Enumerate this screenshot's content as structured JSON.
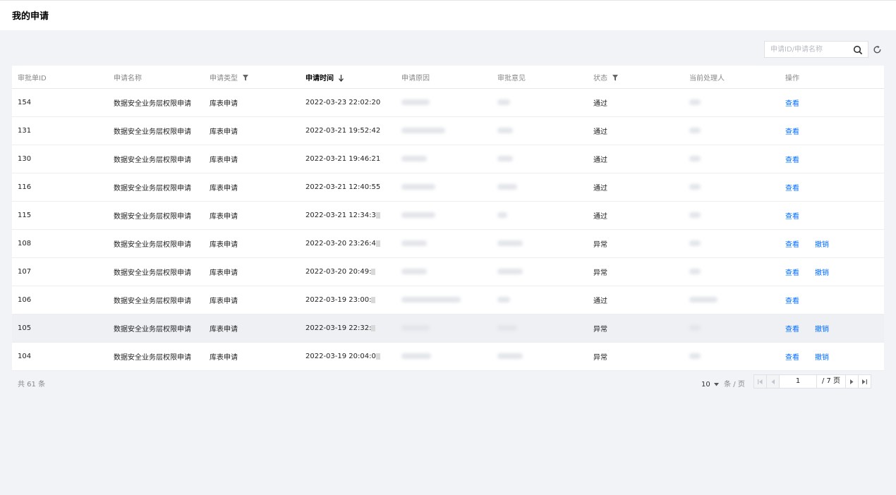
{
  "page": {
    "title": "我的申请"
  },
  "search": {
    "placeholder": "申请ID/申请名称"
  },
  "table": {
    "columns": [
      "审批单ID",
      "申请名称",
      "申请类型",
      "申请时间",
      "申请原因",
      "审批意见",
      "状态",
      "当前处理人",
      "操作"
    ],
    "rows": [
      {
        "id": "154",
        "name": "数据安全业务层权限申请",
        "type": "库表申请",
        "time": "2022-03-23 22:02:20",
        "status": "通过",
        "actions": [
          "查看"
        ]
      },
      {
        "id": "131",
        "name": "数据安全业务层权限申请",
        "type": "库表申请",
        "time": "2022-03-21 19:52:42",
        "status": "通过",
        "actions": [
          "查看"
        ]
      },
      {
        "id": "130",
        "name": "数据安全业务层权限申请",
        "type": "库表申请",
        "time": "2022-03-21 19:46:21",
        "status": "通过",
        "actions": [
          "查看"
        ]
      },
      {
        "id": "116",
        "name": "数据安全业务层权限申请",
        "type": "库表申请",
        "time": "2022-03-21 12:40:55",
        "status": "通过",
        "actions": [
          "查看"
        ]
      },
      {
        "id": "115",
        "name": "数据安全业务层权限申请",
        "type": "库表申请",
        "time": "2022-03-21 12:34:3",
        "status": "通过",
        "actions": [
          "查看"
        ]
      },
      {
        "id": "108",
        "name": "数据安全业务层权限申请",
        "type": "库表申请",
        "time": "2022-03-20 23:26:4",
        "status": "异常",
        "actions": [
          "查看",
          "撤销"
        ]
      },
      {
        "id": "107",
        "name": "数据安全业务层权限申请",
        "type": "库表申请",
        "time": "2022-03-20 20:49:",
        "status": "异常",
        "actions": [
          "查看",
          "撤销"
        ]
      },
      {
        "id": "106",
        "name": "数据安全业务层权限申请",
        "type": "库表申请",
        "time": "2022-03-19 23:00:",
        "status": "通过",
        "actions": [
          "查看"
        ]
      },
      {
        "id": "105",
        "name": "数据安全业务层权限申请",
        "type": "库表申请",
        "time": "2022-03-19 22:32:",
        "status": "异常",
        "actions": [
          "查看",
          "撤销"
        ]
      },
      {
        "id": "104",
        "name": "数据安全业务层权限申请",
        "type": "库表申请",
        "time": "2022-03-19 20:04:0",
        "status": "异常",
        "actions": [
          "查看",
          "撤销"
        ]
      }
    ]
  },
  "footer": {
    "total": "共 61 条",
    "page_size": "10",
    "page_size_unit": "条 / 页",
    "current_page": "1",
    "total_pages": "/ 7 页"
  },
  "colors": {
    "link": "#006eff",
    "background": "#f2f3f7",
    "hover_row": "#eef0f4"
  },
  "icons": [
    "search-icon",
    "refresh-icon",
    "filter-icon",
    "sort-down-icon",
    "first-page-icon",
    "prev-page-icon",
    "next-page-icon",
    "last-page-icon",
    "caret-down-icon"
  ]
}
